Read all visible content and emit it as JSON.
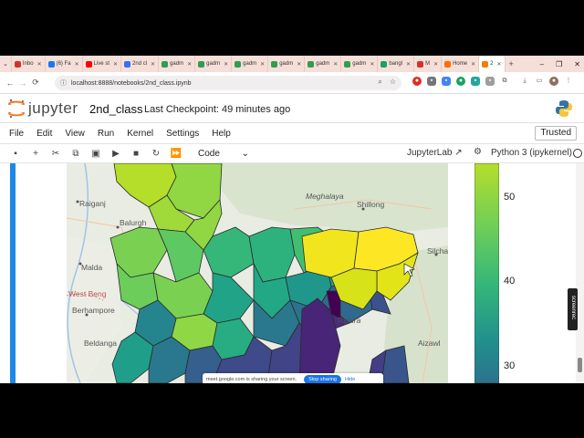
{
  "browser": {
    "tabs": [
      {
        "label": "Inbo",
        "color": "#d93025"
      },
      {
        "label": "(6) Fa",
        "color": "#1877f2"
      },
      {
        "label": "Live st",
        "color": "#ff0000"
      },
      {
        "label": "2nd cl",
        "color": "#3b6ef5"
      },
      {
        "label": "gadm",
        "color": "#2e9e4f"
      },
      {
        "label": "gadm",
        "color": "#2e9e4f"
      },
      {
        "label": "gadm",
        "color": "#2e9e4f"
      },
      {
        "label": "gadm",
        "color": "#2e9e4f"
      },
      {
        "label": "gadm",
        "color": "#2e9e4f"
      },
      {
        "label": "gadm",
        "color": "#2e9e4f"
      },
      {
        "label": "bangl",
        "color": "#1aa260"
      },
      {
        "label": "M",
        "color": "#d93025"
      },
      {
        "label": "Home",
        "color": "#ff6d00"
      },
      {
        "label": "2",
        "color": "#f57c00",
        "active": true
      }
    ],
    "new_tab": "+",
    "url": "localhost:8888/notebooks/2nd_class.ipynb"
  },
  "jupyter": {
    "logo_text": "jupyter",
    "notebook_name": "2nd_class",
    "checkpoint": "Last Checkpoint: 49 minutes ago",
    "menu": [
      "File",
      "Edit",
      "View",
      "Run",
      "Kernel",
      "Settings",
      "Help"
    ],
    "trusted": "Trusted",
    "cell_type": "Code",
    "jupyterlab_link": "JupyterLab",
    "kernel": "Python 3 (ipykernel)"
  },
  "map": {
    "labels": [
      "Raiganj",
      "Balurgh",
      "Malda",
      "West Beng",
      "Berhampore",
      "Beldanga",
      "Meghalaya",
      "Shillong",
      "Silcha",
      "Tripura",
      "Aizawl"
    ]
  },
  "colorbar": {
    "ticks": [
      {
        "value": 50,
        "label": "50"
      },
      {
        "value": 40,
        "label": "40"
      },
      {
        "value": 30,
        "label": "30"
      }
    ],
    "colors": [
      "#fde725",
      "#5ec962",
      "#21918c",
      "#3b528b",
      "#440154"
    ]
  },
  "share_banner": {
    "text": "meet.google.com is sharing your screen.",
    "stop": "Stop sharing",
    "hide": "Hide"
  },
  "screen_recorder": "screenrec"
}
